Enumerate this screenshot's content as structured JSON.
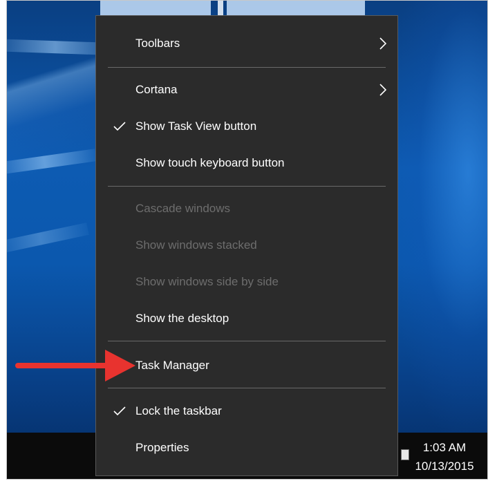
{
  "context_menu": {
    "items": [
      {
        "label": "Toolbars",
        "checked": false,
        "disabled": false,
        "submenu": true
      },
      {
        "label": "Cortana",
        "checked": false,
        "disabled": false,
        "submenu": true
      },
      {
        "label": "Show Task View button",
        "checked": true,
        "disabled": false,
        "submenu": false
      },
      {
        "label": "Show touch keyboard button",
        "checked": false,
        "disabled": false,
        "submenu": false
      },
      {
        "label": "Cascade windows",
        "checked": false,
        "disabled": true,
        "submenu": false
      },
      {
        "label": "Show windows stacked",
        "checked": false,
        "disabled": true,
        "submenu": false
      },
      {
        "label": "Show windows side by side",
        "checked": false,
        "disabled": true,
        "submenu": false
      },
      {
        "label": "Show the desktop",
        "checked": false,
        "disabled": false,
        "submenu": false
      },
      {
        "label": "Task Manager",
        "checked": false,
        "disabled": false,
        "submenu": false,
        "highlighted_by_arrow": true
      },
      {
        "label": "Lock the taskbar",
        "checked": true,
        "disabled": false,
        "submenu": false
      },
      {
        "label": "Properties",
        "checked": false,
        "disabled": false,
        "submenu": false
      }
    ]
  },
  "taskbar": {
    "clock_time": "1:03 AM",
    "clock_date": "10/13/2015"
  },
  "icons": {
    "check": "checkmark-icon",
    "submenu": "chevron-right-icon",
    "annotation": "red-arrow-icon"
  },
  "colors": {
    "menu_background": "#2b2b2b",
    "menu_text": "#ffffff",
    "disabled_text": "#6d6d6d",
    "separator": "#6a6a6a",
    "annotation_arrow": "#e8332f",
    "taskbar": "#0b0b0b"
  }
}
